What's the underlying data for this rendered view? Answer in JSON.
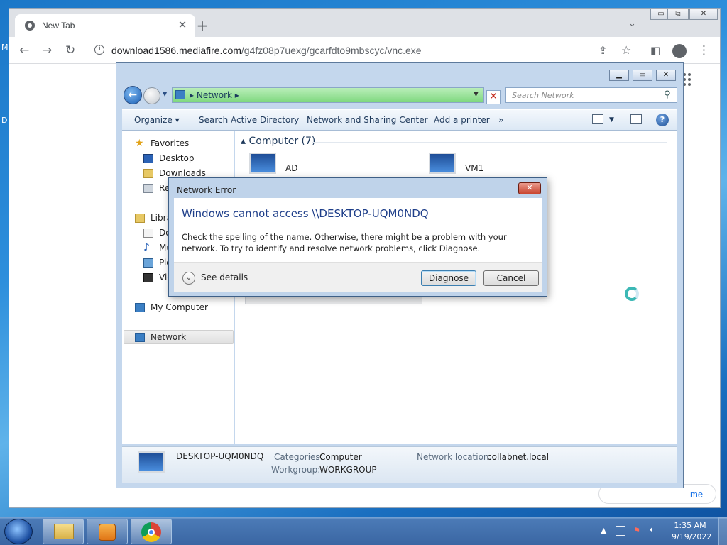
{
  "desktop": {
    "edge_text_1": "M",
    "edge_text_2": "D"
  },
  "chrome": {
    "tab_title": "New Tab",
    "url_host": "download1586.mediafire.com",
    "url_path": "/g4fz08p7uexg/gcarfdto9mbscyc/vnc.exe",
    "hint_pill_text": "me",
    "window_buttons": {
      "minimize": "▭",
      "restore": "⧉",
      "close": "✕"
    }
  },
  "explorer": {
    "address_crumbs": [
      "Network"
    ],
    "search_placeholder": "Search Network",
    "commands": [
      "Organize ▾",
      "Search Active Directory",
      "Network and Sharing Center",
      "Add a printer",
      "»"
    ],
    "nav_tree": {
      "favorites": {
        "label": "Favorites",
        "items": [
          "Desktop",
          "Downloads",
          "Re"
        ]
      },
      "libraries": {
        "label": "Libra",
        "items": [
          "Do",
          "Mu",
          "Pic",
          "Vic"
        ]
      },
      "computer": "My Computer",
      "network": "Network"
    },
    "group_header": "Computer (7)",
    "computers": [
      "AD",
      "VM1"
    ],
    "details": {
      "name": "DESKTOP-UQM0NDQ",
      "categories_label": "Categories:",
      "categories_value": "Computer",
      "workgroup_label": "Workgroup:",
      "workgroup_value": "WORKGROUP",
      "netloc_label": "Network location:",
      "netloc_value": "collabnet.local"
    }
  },
  "dialog": {
    "title": "Network Error",
    "heading": "Windows cannot access \\\\DESKTOP-UQM0NDQ",
    "message": "Check the spelling of the name. Otherwise, there might be a problem with your network. To try to identify and resolve network problems, click Diagnose.",
    "see_details": "See details",
    "diagnose": "Diagnose",
    "cancel": "Cancel"
  },
  "taskbar": {
    "time": "1:35 AM",
    "date": "9/19/2022",
    "tray_expand": "▲"
  },
  "colors": {
    "address_green": "#7fd87f",
    "dialog_heading": "#1f3f8a",
    "close_red": "#c94530",
    "chrome_link": "#1a73e8"
  }
}
